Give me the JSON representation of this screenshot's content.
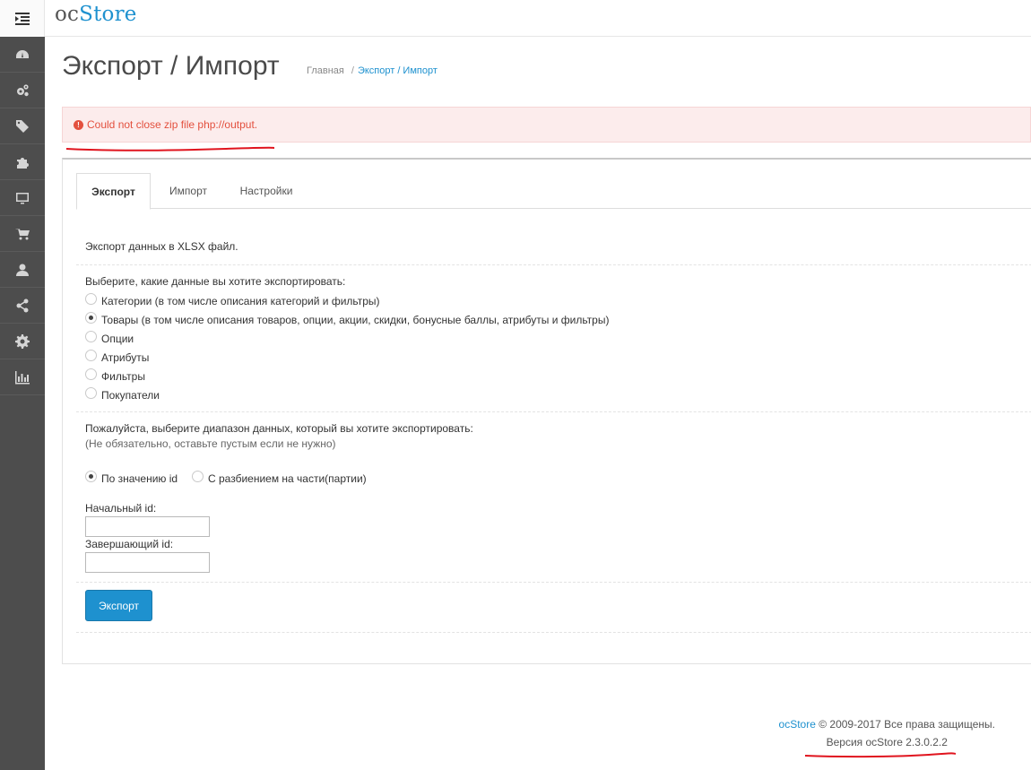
{
  "header": {
    "logo_prefix": "oc",
    "logo_suffix": "Store"
  },
  "sidebar": {
    "items": [
      {
        "icon": "dashboard-icon"
      },
      {
        "icon": "cogs-icon"
      },
      {
        "icon": "tags-icon"
      },
      {
        "icon": "puzzle-icon"
      },
      {
        "icon": "monitor-icon"
      },
      {
        "icon": "cart-icon"
      },
      {
        "icon": "user-icon"
      },
      {
        "icon": "share-icon"
      },
      {
        "icon": "gear-icon"
      },
      {
        "icon": "bar-chart-icon"
      }
    ]
  },
  "page": {
    "title": "Экспорт / Импорт",
    "breadcrumb": {
      "home": "Главная",
      "separator": "/",
      "current": "Экспорт / Импорт"
    }
  },
  "alert": {
    "message": "Could not close zip file php://output."
  },
  "tabs": [
    {
      "label": "Экспорт",
      "active": true
    },
    {
      "label": "Импорт",
      "active": false
    },
    {
      "label": "Настройки",
      "active": false
    }
  ],
  "export": {
    "intro": "Экспорт данных в XLSX файл.",
    "choose_label": "Выберите, какие данные вы хотите экспортировать:",
    "options": [
      {
        "label": "Категории (в том числе описания категорий и фильтры)",
        "checked": false
      },
      {
        "label": "Товары (в том числе описания товаров, опции, акции, скидки, бонусные баллы, атрибуты и фильтры)",
        "checked": true
      },
      {
        "label": "Опции",
        "checked": false
      },
      {
        "label": "Атрибуты",
        "checked": false
      },
      {
        "label": "Фильтры",
        "checked": false
      },
      {
        "label": "Покупатели",
        "checked": false
      }
    ],
    "range_label": "Пожалуйста, выберите диапазон данных, который вы хотите экспортировать:",
    "range_hint": "(Не обязательно, оставьте пустым если не нужно)",
    "range_modes": [
      {
        "label": "По значению id",
        "checked": true
      },
      {
        "label": "С разбиением на части(партии)",
        "checked": false
      }
    ],
    "start_id_label": "Начальный id:",
    "start_id_value": "",
    "end_id_label": "Завершающий id:",
    "end_id_value": "",
    "button_label": "Экспорт"
  },
  "footer": {
    "brand": "ocStore",
    "copyright": "© 2009-2017 Все права защищены.",
    "version": "Версия ocStore 2.3.0.2.2"
  },
  "colors": {
    "accent": "#1e91cf",
    "sidebar_bg": "#4d4d4d",
    "alert_bg": "#fcecec",
    "alert_text": "#e3503e",
    "annotation": "#e0141e"
  }
}
